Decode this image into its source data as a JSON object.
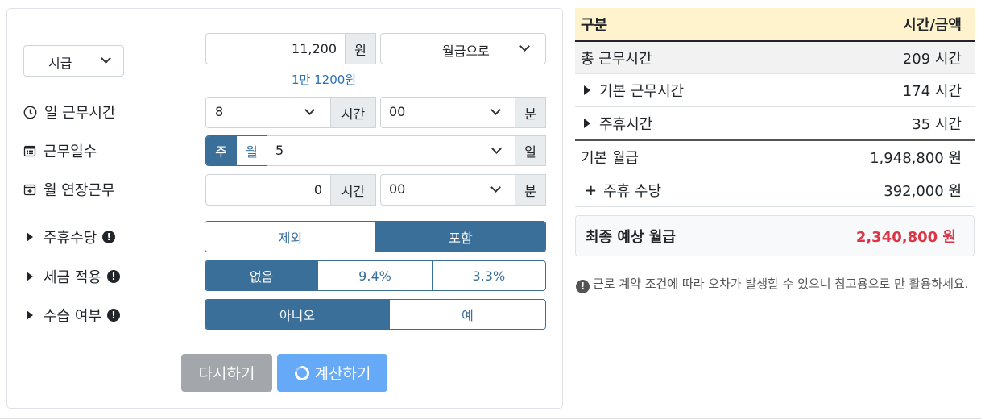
{
  "form": {
    "pay_type": "시급",
    "wage_value": "11,200",
    "wage_unit": "원",
    "convert_select": "월급으로",
    "wage_hint": "1만 1200원",
    "daily_hours": {
      "label": "일 근무시간",
      "hours": "8",
      "hours_unit": "시간",
      "minutes": "00",
      "minutes_unit": "분"
    },
    "work_days": {
      "label": "근무일수",
      "toggle_week": "주",
      "toggle_month": "월",
      "days": "5",
      "days_unit": "일"
    },
    "overtime": {
      "label": "월 연장근무",
      "hours": "0",
      "hours_unit": "시간",
      "minutes": "00",
      "minutes_unit": "분"
    },
    "weekly_allowance": {
      "label": "주휴수당",
      "options": [
        "제외",
        "포함"
      ]
    },
    "tax": {
      "label": "세금 적용",
      "options": [
        "없음",
        "9.4%",
        "3.3%"
      ]
    },
    "probation": {
      "label": "수습 여부",
      "options": [
        "아니오",
        "예"
      ]
    },
    "reset_label": "다시하기",
    "calc_label": "계산하기"
  },
  "result": {
    "header_left": "구분",
    "header_right": "시간/금액",
    "rows": [
      {
        "label": "총 근무시간",
        "value": "209 시간"
      },
      {
        "label": "기본 근무시간",
        "value": "174 시간"
      },
      {
        "label": "주휴시간",
        "value": "35 시간"
      },
      {
        "label": "기본 월급",
        "value": "1,948,800 원"
      },
      {
        "label": "주휴 수당",
        "value": "392,000 원"
      }
    ],
    "plus_sign": "+",
    "total_label": "최종 예상 월급",
    "total_value": "2,340,800 원",
    "notice": "근로 계약 조건에 따라 오차가 발생할 수 있으니 참고용으로 만 활용하세요."
  },
  "colors": {
    "primary": "#3a6f99",
    "header_bg": "#fff3cd",
    "total_red": "#dc3545",
    "reset_gray": "#a3a7ab",
    "calc_blue": "#66aaf7"
  }
}
